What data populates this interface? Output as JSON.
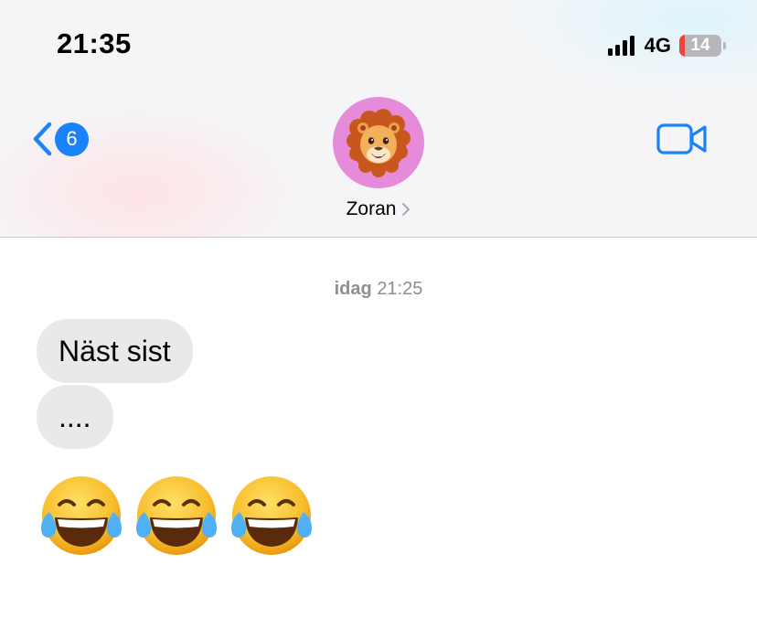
{
  "status_bar": {
    "time": "21:35",
    "network": "4G",
    "battery_level": "14",
    "battery_color": "#f0443a"
  },
  "nav": {
    "back_icon": "chevron-left-icon",
    "unread_count": "6",
    "contact_name": "Zoran",
    "avatar_icon": "lion-memoji-avatar",
    "video_icon": "video-camera-icon",
    "accent_color": "#1a82fb"
  },
  "conversation": {
    "timestamp_day": "idag",
    "timestamp_time": "21:25",
    "messages": [
      {
        "text": "Näst sist",
        "direction": "incoming"
      },
      {
        "text": "....",
        "direction": "incoming"
      }
    ],
    "emoji_message": {
      "count": 3,
      "icon": "face-with-tears-of-joy-icon"
    }
  }
}
